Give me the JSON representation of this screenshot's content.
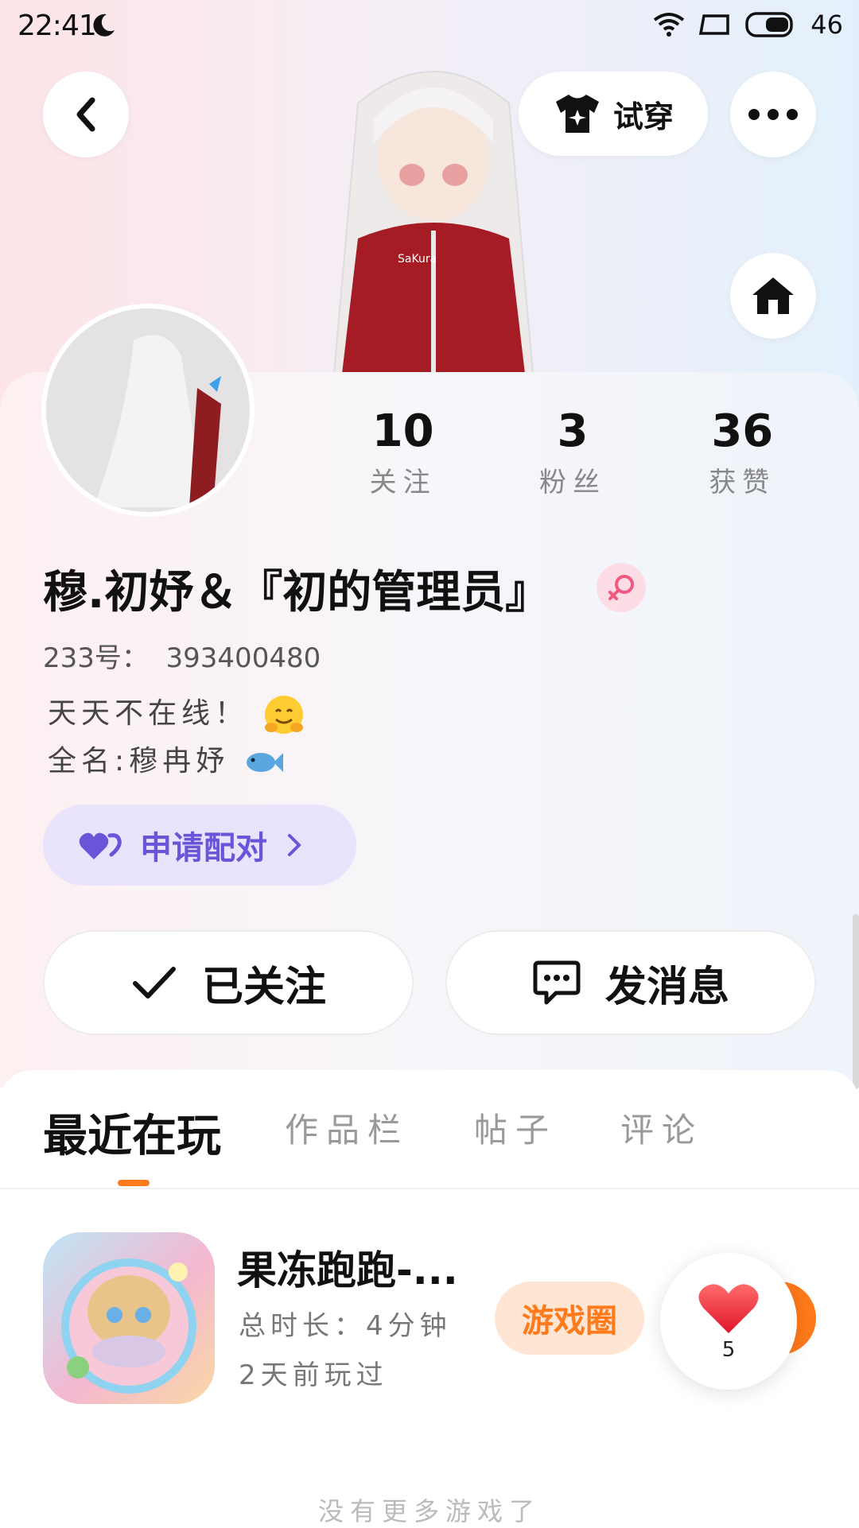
{
  "status_bar": {
    "time": "22:41",
    "battery": "46"
  },
  "header": {
    "try_on_label": "试穿"
  },
  "stats": [
    {
      "value": "10",
      "label": "关注"
    },
    {
      "value": "3",
      "label": "粉丝"
    },
    {
      "value": "36",
      "label": "获赞"
    }
  ],
  "profile": {
    "username": "穆.初妤＆『初的管理员』",
    "uid_label": "233号：",
    "uid": "393400480",
    "bio_line1": "天天不在线！",
    "bio_line2": "全名:穆冉妤",
    "pair_label": "申请配对"
  },
  "actions": {
    "follow_label": "已关注",
    "message_label": "发消息"
  },
  "tabs": [
    {
      "label": "最近在玩",
      "active": true
    },
    {
      "label": "作品栏",
      "active": false
    },
    {
      "label": "帖子",
      "active": false
    },
    {
      "label": "评论",
      "active": false
    }
  ],
  "game": {
    "title": "果冻跑跑-...",
    "duration": "总时长：4分钟",
    "last_played": "2天前玩过",
    "circle_label": "游戏圈"
  },
  "like": {
    "count": "5"
  },
  "footer": "没有更多游戏了",
  "colors": {
    "accent": "#ff7a1a",
    "pair": "#6a55d8",
    "gender": "#fddde5"
  }
}
